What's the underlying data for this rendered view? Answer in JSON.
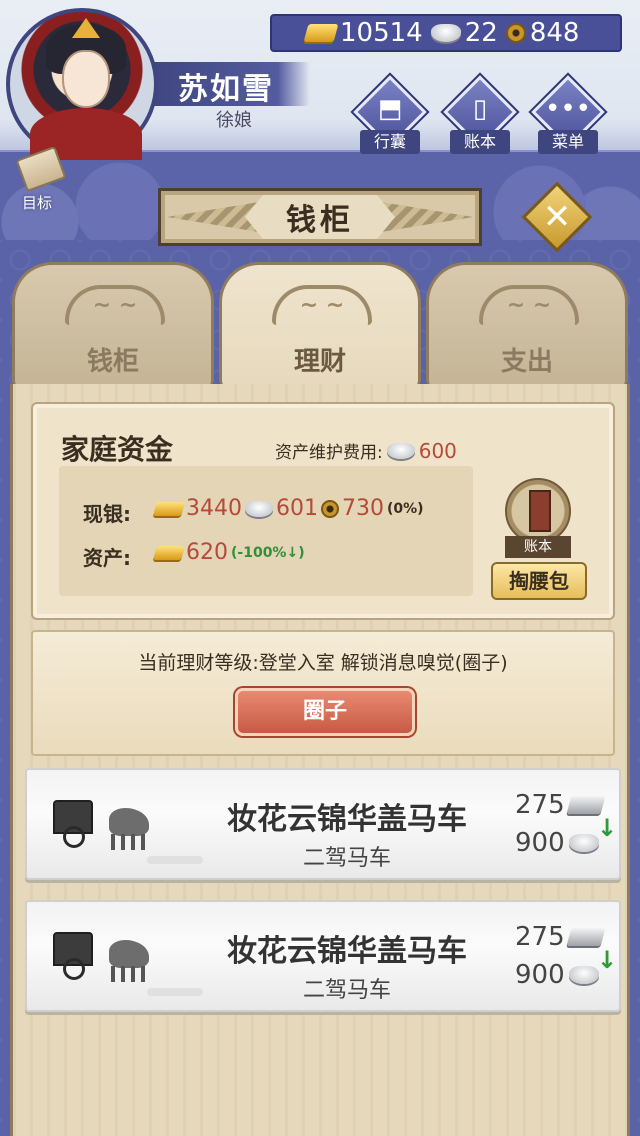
{
  "header": {
    "currency": {
      "gold": "10514",
      "silver": "22",
      "copper": "848"
    },
    "player": {
      "name": "苏如雪",
      "title": "徐娘"
    },
    "goal_label": "目标",
    "buttons": [
      {
        "label": "行囊",
        "icon": "bag-icon"
      },
      {
        "label": "账本",
        "icon": "ledger-icon"
      },
      {
        "label": "菜单",
        "icon": "menu-icon"
      }
    ]
  },
  "page_title": "钱柜",
  "close_icon": "close-icon",
  "tabs": [
    {
      "label": "钱柜",
      "active": false
    },
    {
      "label": "理财",
      "active": true
    },
    {
      "label": "支出",
      "active": false
    }
  ],
  "funds": {
    "title": "家庭资金",
    "fee_label": "资产维护费用:",
    "fee_value": "600",
    "cash_label": "现银:",
    "cash_gold": "3440",
    "cash_silver": "601",
    "cash_copper": "730",
    "cash_pct": "(0%)",
    "asset_label": "资产:",
    "asset_gold": "620",
    "asset_pct": "(-100%↓)",
    "ledger_label": "账本",
    "pocket_button": "掏腰包"
  },
  "level": {
    "text": "当前理财等级:登堂入室 解锁消息嗅觉(圈子)",
    "button": "圈子"
  },
  "items": [
    {
      "name": "妆花云锦华盖马车",
      "sub": "二驾马车",
      "price_silver_bar": "275",
      "price_silver": "900",
      "trend": "↓"
    },
    {
      "name": "妆花云锦华盖马车",
      "sub": "二驾马车",
      "price_silver_bar": "275",
      "price_silver": "900",
      "trend": "↓"
    }
  ],
  "colors": {
    "accent_red": "#b44a3a",
    "green": "#2f8f3a",
    "indigo": "#5a62a8"
  }
}
